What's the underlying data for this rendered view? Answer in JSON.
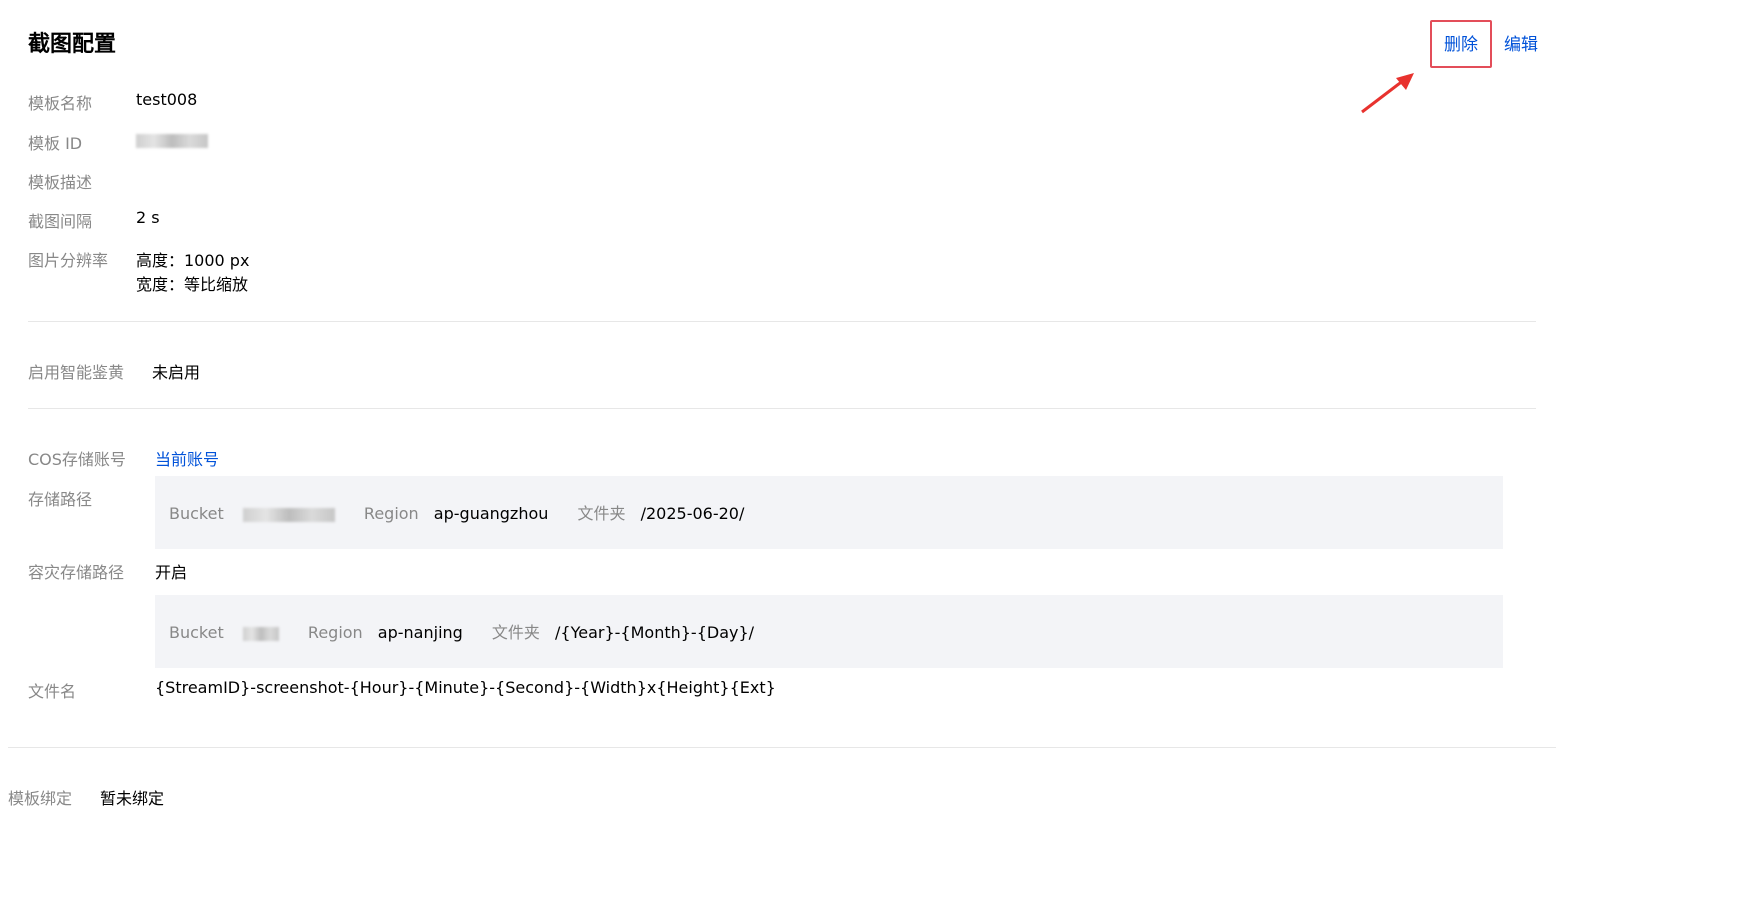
{
  "header": {
    "title": "截图配置",
    "delete_label": "删除",
    "edit_label": "编辑"
  },
  "basic": {
    "name_label": "模板名称",
    "name_value": "test008",
    "id_label": "模板 ID",
    "desc_label": "模板描述",
    "interval_label": "截图间隔",
    "interval_value": "2 s",
    "resolution_label": "图片分辨率",
    "height_line": "高度：1000 px",
    "width_line": "宽度：等比缩放"
  },
  "moderation": {
    "label": "启用智能鉴黄",
    "value": "未启用"
  },
  "storage": {
    "cos_label": "COS存储账号",
    "cos_value": "当前账号",
    "path_label": "存储路径",
    "primary": {
      "bucket_label": "Bucket",
      "region_label": "Region",
      "region_value": "ap-guangzhou",
      "folder_label": "文件夹",
      "folder_value": "/2025-06-20/"
    },
    "dr_label": "容灾存储路径",
    "dr_value": "开启",
    "backup": {
      "bucket_label": "Bucket",
      "region_label": "Region",
      "region_value": "ap-nanjing",
      "folder_label": "文件夹",
      "folder_value": "/{Year}-{Month}-{Day}/"
    },
    "filename_label": "文件名",
    "filename_value": "{StreamID}-screenshot-{Hour}-{Minute}-{Second}-{Width}x{Height}{Ext}"
  },
  "binding": {
    "label": "模板绑定",
    "value": "暂未绑定"
  },
  "colors": {
    "link": "#0052d9",
    "highlight_box": "#e34d59",
    "label_gray": "#888888",
    "panel_bg": "#f3f4f7"
  }
}
